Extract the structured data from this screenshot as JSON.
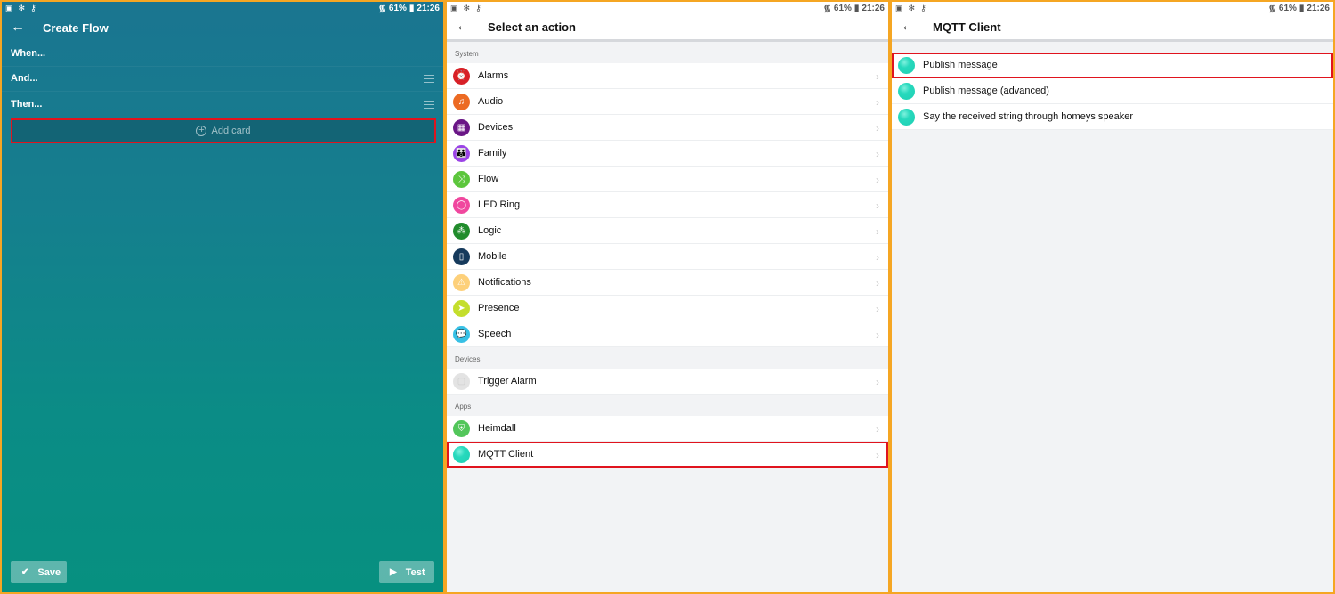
{
  "status_bar": {
    "battery": "61%",
    "time": "21:26"
  },
  "panel1": {
    "title": "Create Flow",
    "rows": [
      {
        "label": "When...",
        "has_menu": false
      },
      {
        "label": "And...",
        "has_menu": true
      },
      {
        "label": "Then...",
        "has_menu": true
      }
    ],
    "add_card_label": "Add card",
    "save_label": "Save",
    "test_label": "Test"
  },
  "panel2": {
    "title": "Select an action",
    "sections": [
      {
        "header": "System",
        "items": [
          {
            "label": "Alarms",
            "icon": "alarm-clock-icon",
            "color": "#d72027"
          },
          {
            "label": "Audio",
            "icon": "music-note-icon",
            "color": "#ec6a23"
          },
          {
            "label": "Devices",
            "icon": "devices-grid-icon",
            "color": "#6a1686"
          },
          {
            "label": "Family",
            "icon": "family-icon",
            "color": "#9b43e6"
          },
          {
            "label": "Flow",
            "icon": "flow-icon",
            "color": "#5cc63c"
          },
          {
            "label": "LED Ring",
            "icon": "led-ring-icon",
            "color": "#f0479e"
          },
          {
            "label": "Logic",
            "icon": "logic-icon",
            "color": "#218c2c"
          },
          {
            "label": "Mobile",
            "icon": "mobile-icon",
            "color": "#163a5c"
          },
          {
            "label": "Notifications",
            "icon": "notification-icon",
            "color": "#fdd07a"
          },
          {
            "label": "Presence",
            "icon": "presence-arrow-icon",
            "color": "#c4de2c"
          },
          {
            "label": "Speech",
            "icon": "speech-bubble-icon",
            "color": "#37c0e5"
          }
        ]
      },
      {
        "header": "Devices",
        "items": [
          {
            "label": "Trigger Alarm",
            "icon": "device-icon",
            "color": "#e3e3e3"
          }
        ]
      },
      {
        "header": "Apps",
        "items": [
          {
            "label": "Heimdall",
            "icon": "heimdall-icon",
            "color": "#52c65a"
          },
          {
            "label": "MQTT Client",
            "icon": "mqtt-client-icon",
            "color": "#27d9bd",
            "highlighted": true
          }
        ]
      }
    ]
  },
  "panel3": {
    "title": "MQTT Client",
    "items": [
      {
        "label": "Publish message",
        "highlighted": true
      },
      {
        "label": "Publish message (advanced)"
      },
      {
        "label": "Say the received string through homeys speaker"
      }
    ]
  },
  "colors": {
    "highlight": "#e0141e",
    "frame": "#f5a623"
  }
}
